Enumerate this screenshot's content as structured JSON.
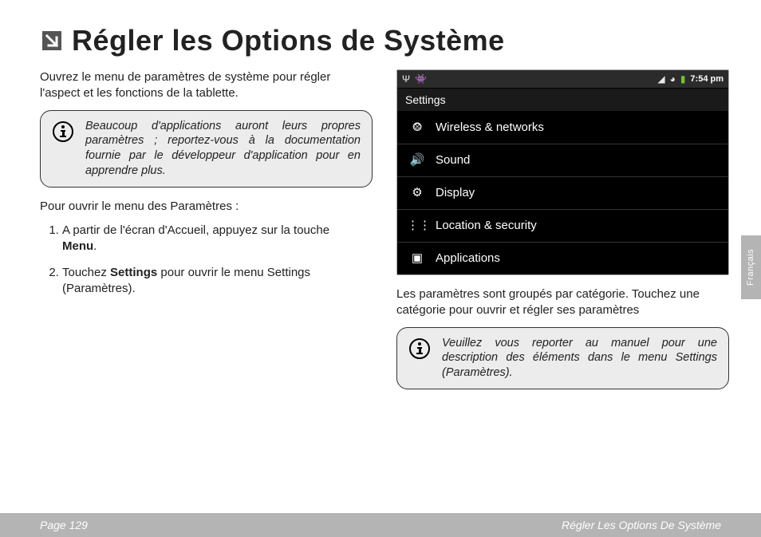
{
  "heading": "Régler les Options de Système",
  "left": {
    "intro": "Ouvrez le menu de paramètres de système pour régler l'aspect et les fonctions de la tablette.",
    "note": "Beaucoup d'applications auront leurs propres paramètres ; reportez-vous à la documentation fournie par le développeur d'application pour en apprendre plus.",
    "open_title": "Pour ouvrir le menu des Paramètres :",
    "step1_pre": "A partir de l'écran d'Accueil, appuyez sur la touche ",
    "step1_bold": "Menu",
    "step1_post": ".",
    "step2_pre": "Touchez ",
    "step2_bold": "Settings",
    "step2_post": " pour ouvrir le menu Settings (Paramètres)."
  },
  "right": {
    "caption": "Les paramètres sont groupés par catégorie. Touchez une catégorie pour ouvrir et régler ses paramètres",
    "note": "Veuillez vous reporter au manuel pour une description des éléments dans le menu Settings (Paramètres)."
  },
  "screenshot": {
    "time": "7:54 pm",
    "title": "Settings",
    "items": [
      {
        "icon": "wifi-icon",
        "glyph": "⨷",
        "label": "Wireless & networks"
      },
      {
        "icon": "sound-icon",
        "glyph": "🔊",
        "label": "Sound"
      },
      {
        "icon": "display-icon",
        "glyph": "⚙",
        "label": "Display"
      },
      {
        "icon": "location-icon",
        "glyph": "⋮⋮",
        "label": "Location & security"
      },
      {
        "icon": "apps-icon",
        "glyph": "▣",
        "label": "Applications"
      }
    ]
  },
  "lang_tab": "Français",
  "footer": {
    "page": "Page 129",
    "section": "Régler Les Options De Système"
  }
}
